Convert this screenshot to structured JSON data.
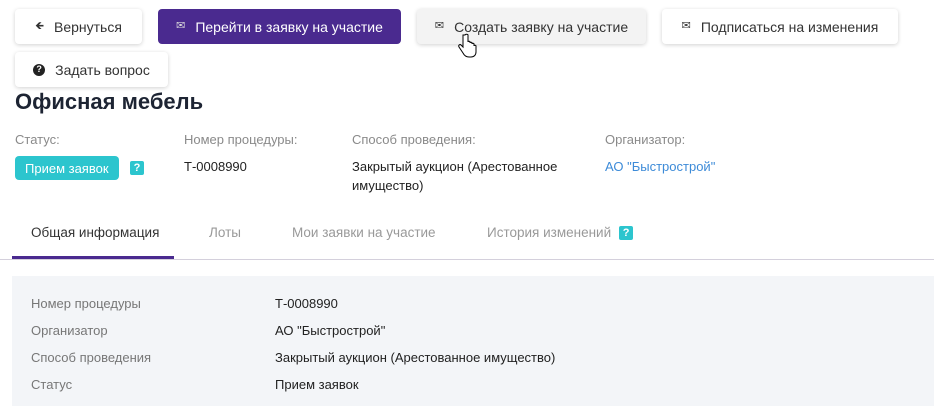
{
  "toolbar": {
    "back": {
      "label": "Вернуться",
      "icon": "arrow-left-icon"
    },
    "go_to_application": {
      "label": "Перейти в заявку на участие",
      "icon": "envelope-open-icon"
    },
    "create_application": {
      "label": "Создать заявку на участие",
      "icon": "envelope-icon"
    },
    "subscribe": {
      "label": "Подписаться на изменения",
      "icon": "envelope-send-icon"
    },
    "ask_question": {
      "label": "Задать вопрос",
      "icon": "question-circle-icon"
    }
  },
  "page_title": "Офисная мебель",
  "summary": {
    "status_label": "Статус:",
    "status_value": "Прием заявок",
    "number_label": "Номер процедуры:",
    "number_value": "Т-0008990",
    "method_label": "Способ проведения:",
    "method_value": "Закрытый аукцион (Арестованное имущество)",
    "organizer_label": "Организатор:",
    "organizer_value": "АО \"Быстрострой\"",
    "help": "?"
  },
  "tabs": [
    {
      "label": "Общая информация",
      "active": true
    },
    {
      "label": "Лоты"
    },
    {
      "label": "Мои заявки на участие"
    },
    {
      "label": "История изменений"
    }
  ],
  "details": [
    {
      "label": "Номер процедуры",
      "value": "Т-0008990"
    },
    {
      "label": "Организатор",
      "value": "АО \"Быстрострой\""
    },
    {
      "label": "Способ проведения",
      "value": "Закрытый аукцион (Арестованное имущество)"
    },
    {
      "label": "Статус",
      "value": "Прием заявок"
    }
  ],
  "colors": {
    "primary": "#4a2a8f",
    "accent": "#2cc5ce",
    "link": "#3d8bd8"
  }
}
